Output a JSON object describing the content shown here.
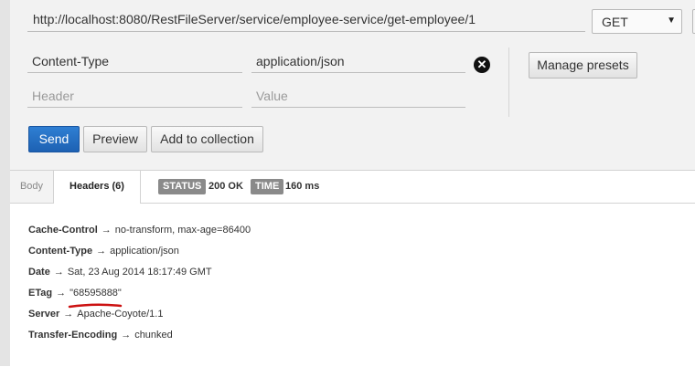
{
  "request": {
    "url": "http://localhost:8080/RestFileServer/service/employee-service/get-employee/1",
    "method": "GET",
    "headers": [
      {
        "key": "Content-Type",
        "value": "application/json"
      }
    ],
    "new_header_placeholder": "Header",
    "new_value_placeholder": "Value",
    "manage_presets_label": "Manage presets"
  },
  "actions": {
    "send_label": "Send",
    "preview_label": "Preview",
    "add_to_collection_label": "Add to collection"
  },
  "response": {
    "tabs": [
      {
        "label": "Body",
        "active": false
      },
      {
        "label": "Headers (6)",
        "active": true
      }
    ],
    "status_label": "STATUS",
    "status_value": "200 OK",
    "time_label": "TIME",
    "time_value": "160 ms",
    "arrow": "→",
    "headers": [
      {
        "name": "Cache-Control",
        "value": "no-transform, max-age=86400"
      },
      {
        "name": "Content-Type",
        "value": "application/json"
      },
      {
        "name": "Date",
        "value": "Sat, 23 Aug 2014 18:17:49 GMT"
      },
      {
        "name": "ETag",
        "value": "\"68595888\""
      },
      {
        "name": "Server",
        "value": "Apache-Coyote/1.1"
      },
      {
        "name": "Transfer-Encoding",
        "value": "chunked"
      }
    ]
  },
  "colors": {
    "primary_button": "#1d61b3",
    "badge": "#8a8a8a",
    "annotation_underline": "#cc1111"
  },
  "icons": {
    "remove_header": "remove-header-icon",
    "method_dropdown": "chevron-down-icon"
  }
}
